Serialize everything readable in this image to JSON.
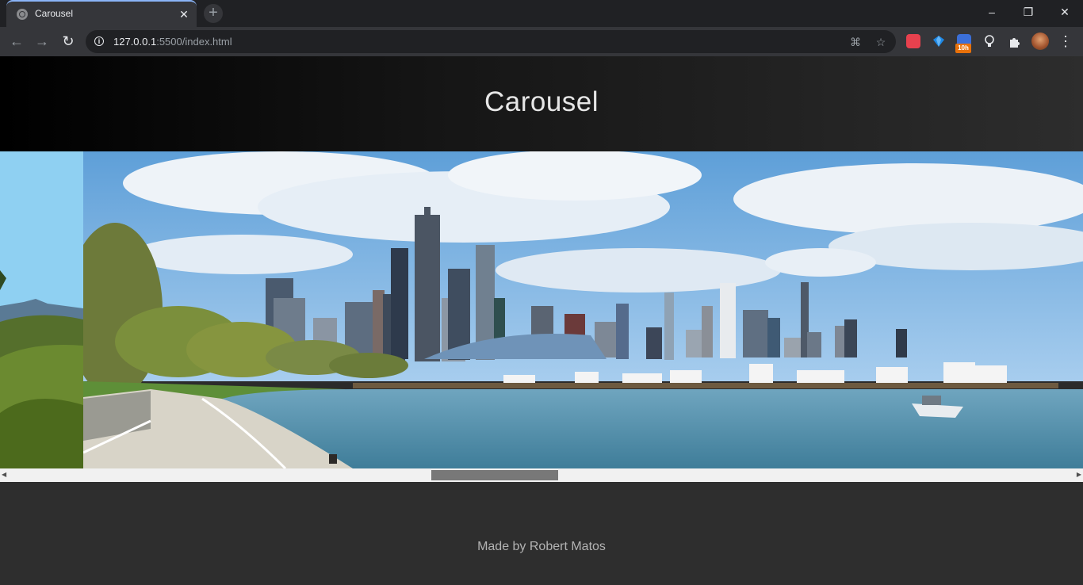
{
  "browser": {
    "tab_title": "Carousel",
    "tab_close": "✕",
    "new_tab": "+",
    "url_host": "127.0.0.1",
    "url_rest": ":5500/index.html",
    "extension_badge": "10h",
    "window_minimize": "–",
    "window_restore": "❐",
    "window_close": "✕"
  },
  "page": {
    "title": "Carousel",
    "footer_credit": "Made by Robert Matos"
  },
  "carousel": {
    "scroll_position_fraction": 0.45,
    "visible_fraction": 0.12
  },
  "colors": {
    "sky_top": "#5e9fd8",
    "water": "#4f8eab",
    "scroll_thumb": "#787878"
  }
}
